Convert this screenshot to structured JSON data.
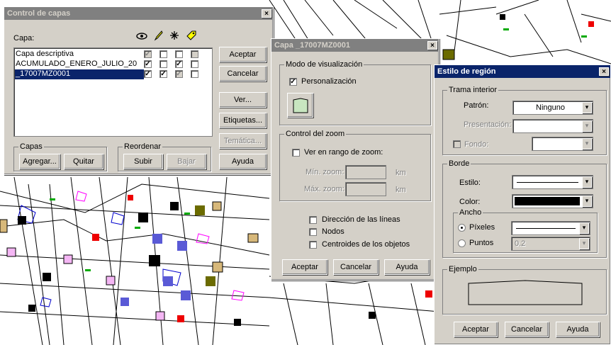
{
  "capas_dialog": {
    "title": "Control de capas",
    "close": "×",
    "capa_label": "Capa:",
    "layers": [
      {
        "name": "Capa descriptiva",
        "checks": [
          "grey",
          "off",
          "off",
          "grey"
        ],
        "selected": false
      },
      {
        "name": "ACUMULADO_ENERO_JULIO_20",
        "checks": [
          "on",
          "off",
          "on",
          "off"
        ],
        "selected": false
      },
      {
        "name": "_17007MZ0001",
        "checks": [
          "on",
          "on",
          "grey",
          "off"
        ],
        "selected": true
      }
    ],
    "buttons": {
      "aceptar": "Aceptar",
      "cancelar": "Cancelar",
      "ver": "Ver...",
      "etiquetas": "Etiquetas...",
      "tematica": "Temática...",
      "ayuda": "Ayuda",
      "agregar": "Agregar...",
      "quitar": "Quitar",
      "subir": "Subir",
      "bajar": "Bajar"
    },
    "groups": {
      "capas": "Capas",
      "reordenar": "Reordenar"
    },
    "header_icons": [
      "eye-icon",
      "pencil-icon",
      "sparkle-icon",
      "tag-icon"
    ]
  },
  "capa_dialog": {
    "title": "Capa _17007MZ0001",
    "close": "×",
    "modo_group": "Modo de visualización",
    "personalizacion": "Personalización",
    "zoom_group": "Control del zoom",
    "ver_rango": "Ver en rango de zoom:",
    "min_zoom": "Mín. zoom:",
    "max_zoom": "Máx. zoom:",
    "km1": "km",
    "km2": "km",
    "direccion": "Dirección de las líneas",
    "nodos": "Nodos",
    "centroides": "Centroides de los objetos",
    "aceptar": "Aceptar",
    "cancelar": "Cancelar",
    "ayuda": "Ayuda"
  },
  "estilo_dialog": {
    "title": "Estilo de región",
    "close": "×",
    "trama_group": "Trama interior",
    "patron": "Patrón:",
    "patron_value": "Ninguno",
    "presentacion": "Presentación:",
    "fondo": "Fondo:",
    "borde_group": "Borde",
    "estilo": "Estilo:",
    "color": "Color:",
    "ancho_group": "Ancho",
    "pixeles": "Píxeles",
    "puntos": "Puntos",
    "puntos_value": "0.2",
    "ejemplo_group": "Ejemplo",
    "aceptar": "Aceptar",
    "cancelar": "Cancelar",
    "ayuda": "Ayuda"
  },
  "colors": {
    "titlebar_active": "#0a246a",
    "titlebar_inactive": "#808080",
    "dialog": "#d4d0c8",
    "preview_fill": "#c8e6c0"
  }
}
